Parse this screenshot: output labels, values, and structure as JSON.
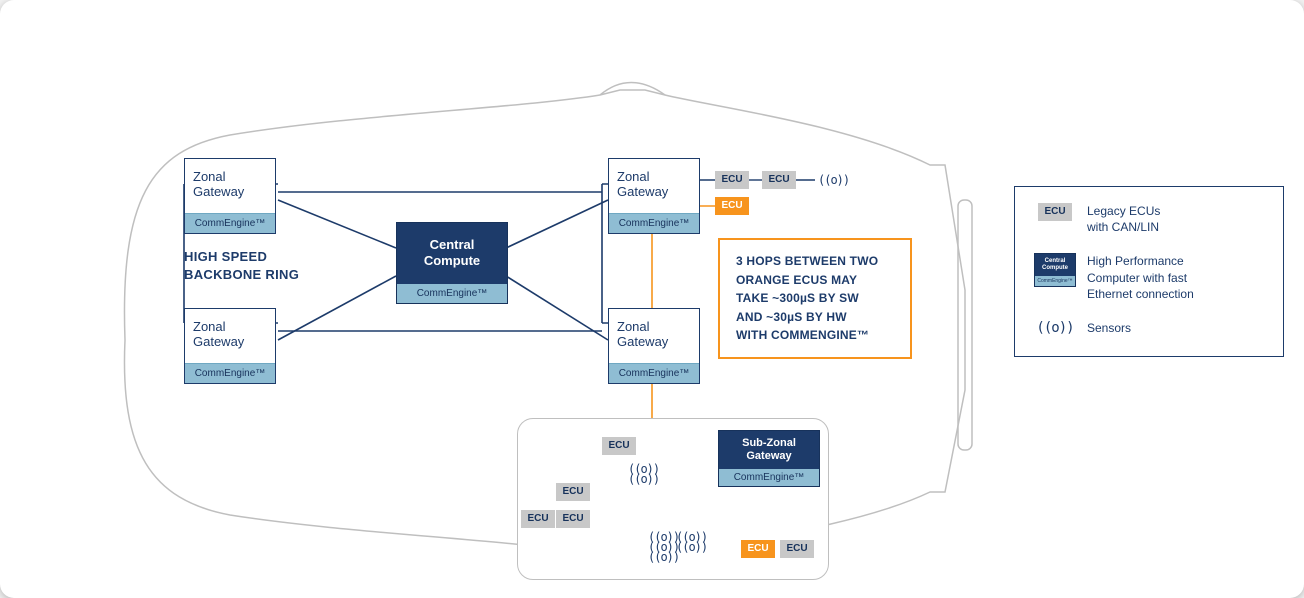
{
  "gateways": {
    "tl": {
      "title": "Zonal\nGateway",
      "foot": "CommEngine™"
    },
    "bl": {
      "title": "Zonal\nGateway",
      "foot": "CommEngine™"
    },
    "tr": {
      "title": "Zonal\nGateway",
      "foot": "CommEngine™"
    },
    "br": {
      "title": "Zonal\nGateway",
      "foot": "CommEngine™"
    }
  },
  "central": {
    "title": "Central\nCompute",
    "foot": "CommEngine™"
  },
  "subgw": {
    "title": "Sub-Zonal\nGateway",
    "foot": "CommEngine™"
  },
  "ecu_label": "ECU",
  "backbone": "HIGH SPEED\nBACKBONE RING",
  "callout": "3 HOPS BETWEEN TWO\nORANGE ECUS MAY\nTAKE ~300µS BY SW\nAND ~30µS BY HW\nWITH COMMENGINE™",
  "sensor_glyph": "((o))",
  "legend": {
    "ecu": {
      "label": "ECU",
      "text": "Legacy ECUs\nwith CAN/LIN"
    },
    "hpc": {
      "title": "Central\nCompute",
      "foot": "CommEngine™",
      "text": "High Performance\nComputer with fast\nEthernet connection"
    },
    "sensor": {
      "text": "Sensors"
    }
  }
}
